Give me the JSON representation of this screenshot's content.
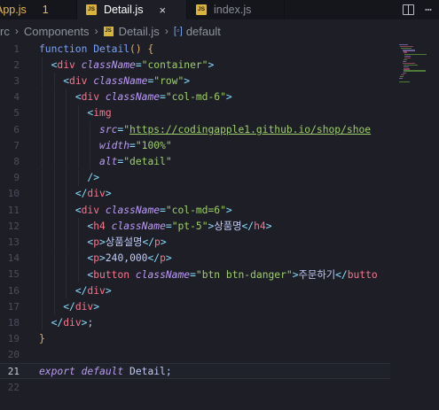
{
  "tabs": [
    {
      "label": "App.js",
      "badge": "JS",
      "count": "1"
    },
    {
      "label": "Detail.js",
      "badge": "JS",
      "close": "×"
    },
    {
      "label": "index.js",
      "badge": "JS"
    }
  ],
  "breadcrumb": {
    "items": [
      "rc",
      "Components",
      "Detail.js",
      "default"
    ],
    "file_badge": "JS",
    "symbol_icon": "symbol-variable-icon"
  },
  "editor": {
    "current_line": 21,
    "line_numbers": [
      "1",
      "2",
      "3",
      "4",
      "5",
      "6",
      "7",
      "8",
      "9",
      "10",
      "11",
      "12",
      "13",
      "14",
      "15",
      "16",
      "17",
      "18",
      "19",
      "20",
      "21",
      "22"
    ],
    "lines": [
      "function Detail() {",
      "  <div className=\"container\">",
      "    <div className=\"row\">",
      "      <div className=\"col-md-6\">",
      "        <img",
      "          src=\"https://codingapple1.github.io/shop/shoe",
      "          width=\"100%\"",
      "          alt=\"detail\"",
      "        />",
      "      </div>",
      "      <div className=\"col-md=6\">",
      "        <h4 className=\"pt-5\">상품명</h4>",
      "        <p>상품설명</p>",
      "        <p>240,000</p>",
      "        <button className=\"btn btn-danger\">주문하기</butto",
      "      </div>",
      "    </div>",
      "  </div>;",
      "}",
      "",
      "export default Detail;",
      ""
    ]
  },
  "colors": {
    "background": "#1e1f26",
    "keyword": "#bb9af7",
    "function": "#7aa2f7",
    "tag": "#f7768e",
    "string": "#9ece6a",
    "js_badge": "#d9b43c",
    "modified": "#e5b85b"
  }
}
